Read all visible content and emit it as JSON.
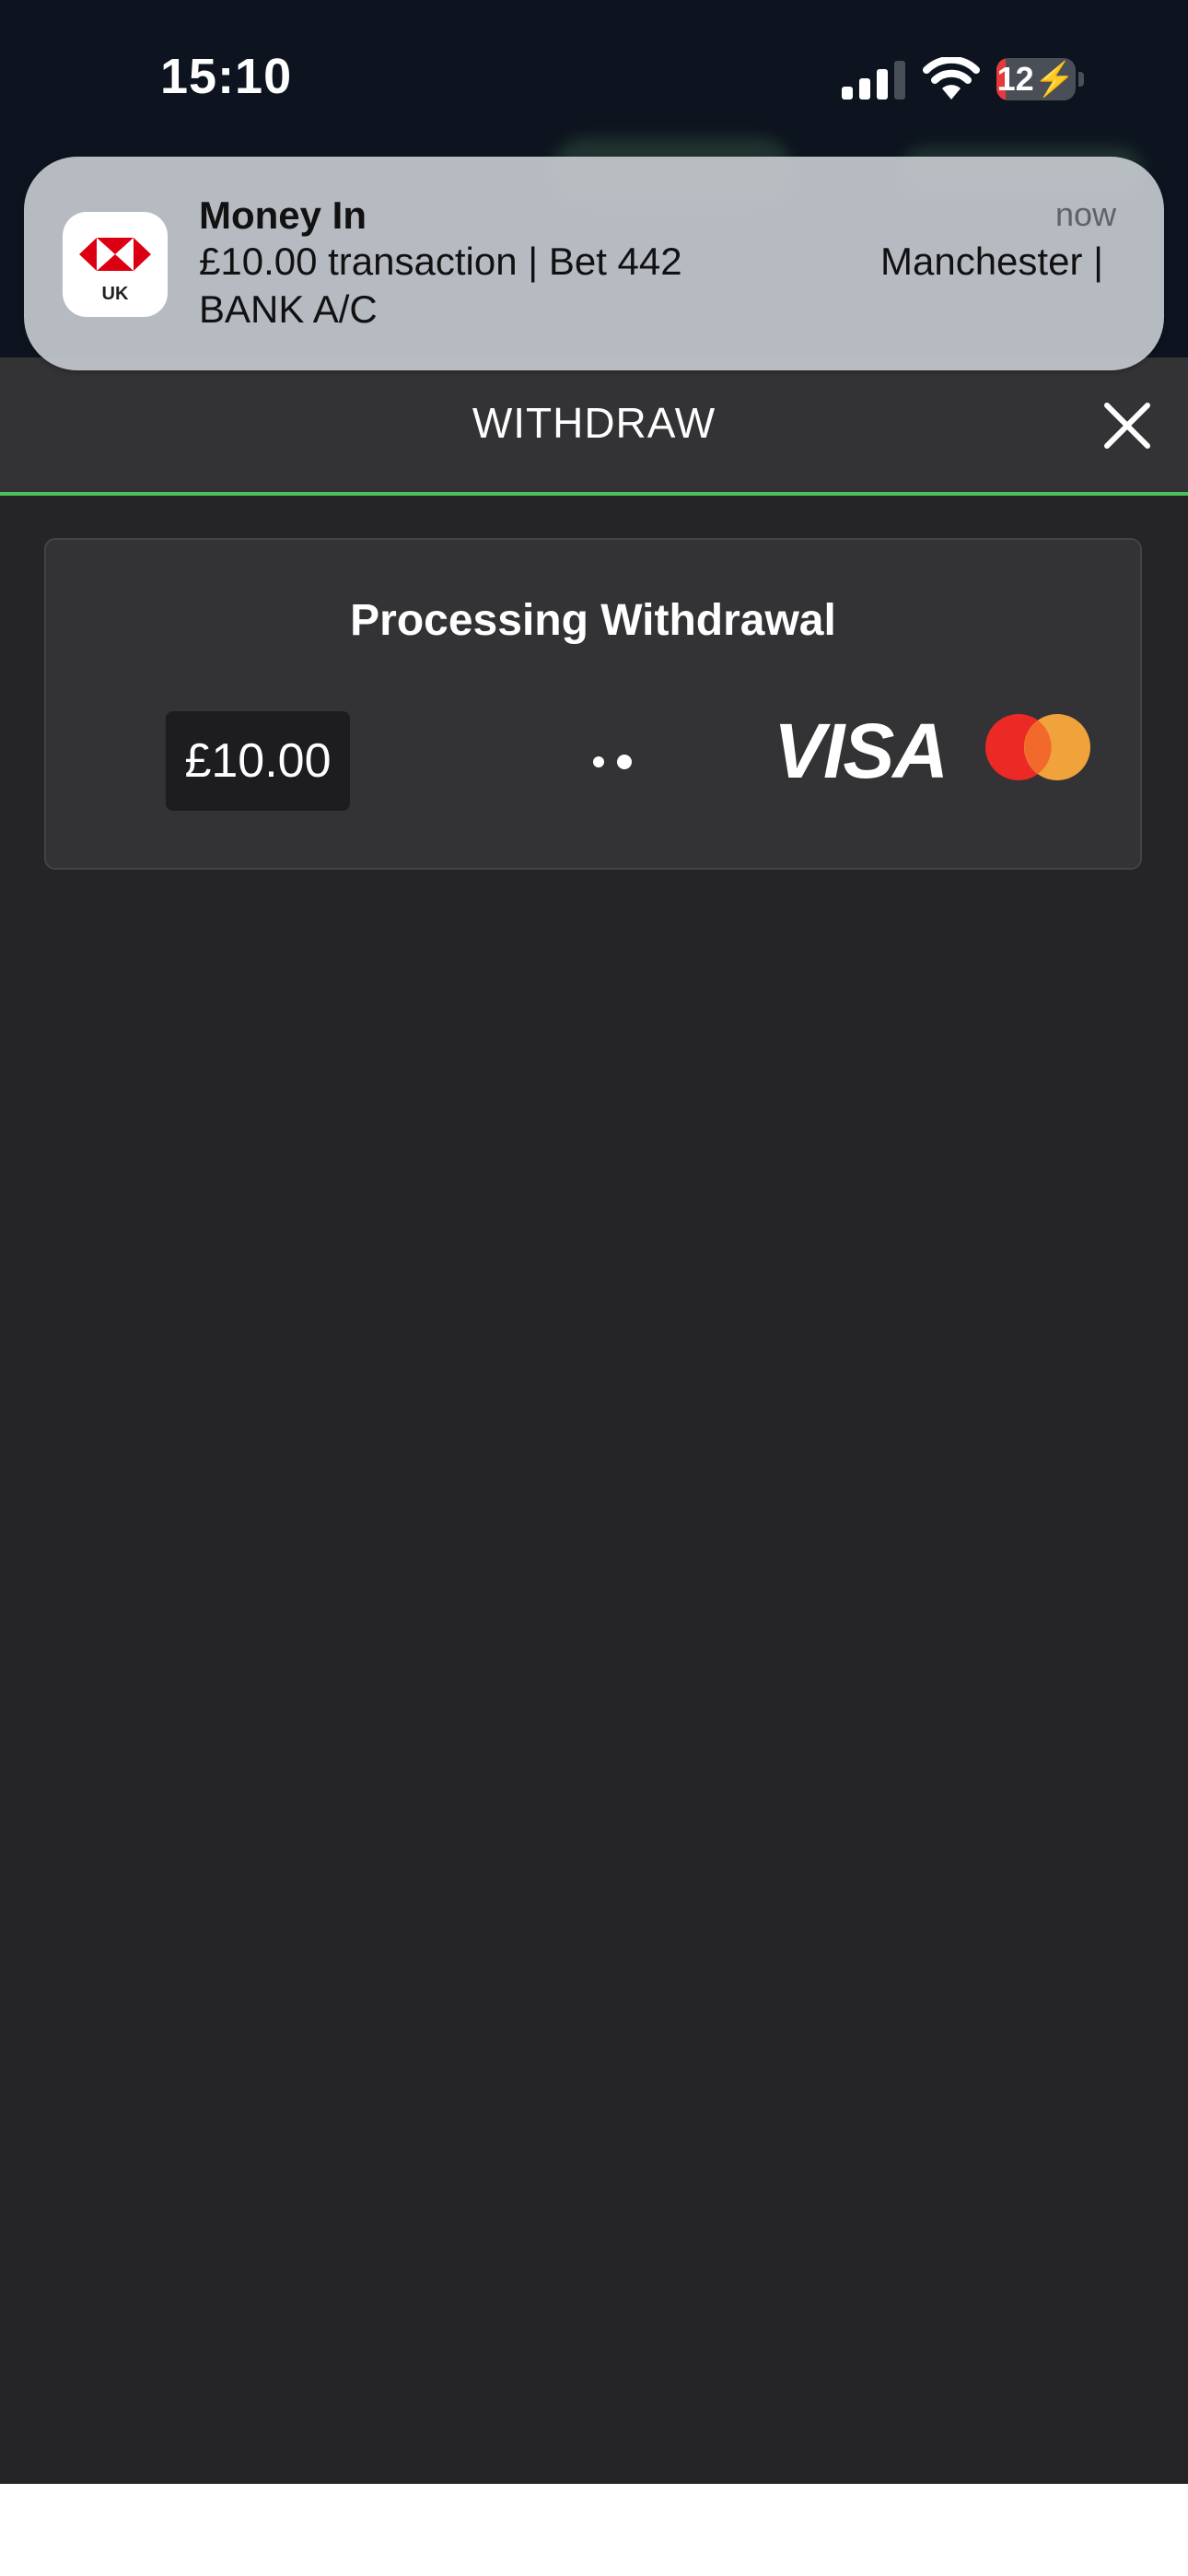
{
  "status_bar": {
    "time": "15:10",
    "battery_level": "12",
    "battery_fraction": 0.12,
    "icons": [
      "signal-icon",
      "wifi-icon",
      "battery-charging-icon"
    ]
  },
  "notification": {
    "app_badge": "UK",
    "title": "Money In",
    "time": "now",
    "body_line1_left": "£10.00 transaction | Bet 442",
    "body_line1_right": "Manchester |",
    "body_line2": "BANK A/C"
  },
  "withdraw": {
    "title": "WITHDRAW",
    "card_title": "Processing Withdrawal",
    "amount": "£10.00",
    "payment_logos": [
      "visa-logo",
      "mastercard-logo"
    ]
  },
  "colors": {
    "accent_green": "#4cc25a",
    "modal_background": "#252427",
    "card_background": "#333235",
    "battery_low": "#e5393a",
    "mastercard_red": "#eb2a26",
    "mastercard_orange": "#f0a33a"
  }
}
